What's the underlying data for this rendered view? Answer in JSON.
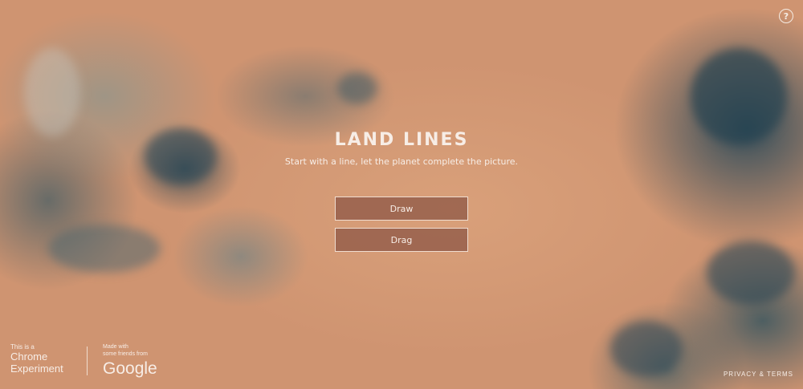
{
  "header": {
    "help_label": "?"
  },
  "main": {
    "title": "LAND LINES",
    "subtitle": "Start with a line, let the planet complete the picture.",
    "buttons": {
      "draw": "Draw",
      "drag": "Drag"
    }
  },
  "footer": {
    "chrome_small": "This is a",
    "chrome_line1": "Chrome",
    "chrome_line2": "Experiment",
    "google_small_1": "Made with",
    "google_small_2": "some friends from",
    "google_logo": "Google",
    "privacy": "PRIVACY & TERMS"
  },
  "icons": {
    "help": "help-circle-icon"
  },
  "colors": {
    "text": "#f7ede6",
    "button_bg": "#965f4b",
    "sand": "#d6a07c",
    "water": "#2d4b5a"
  }
}
